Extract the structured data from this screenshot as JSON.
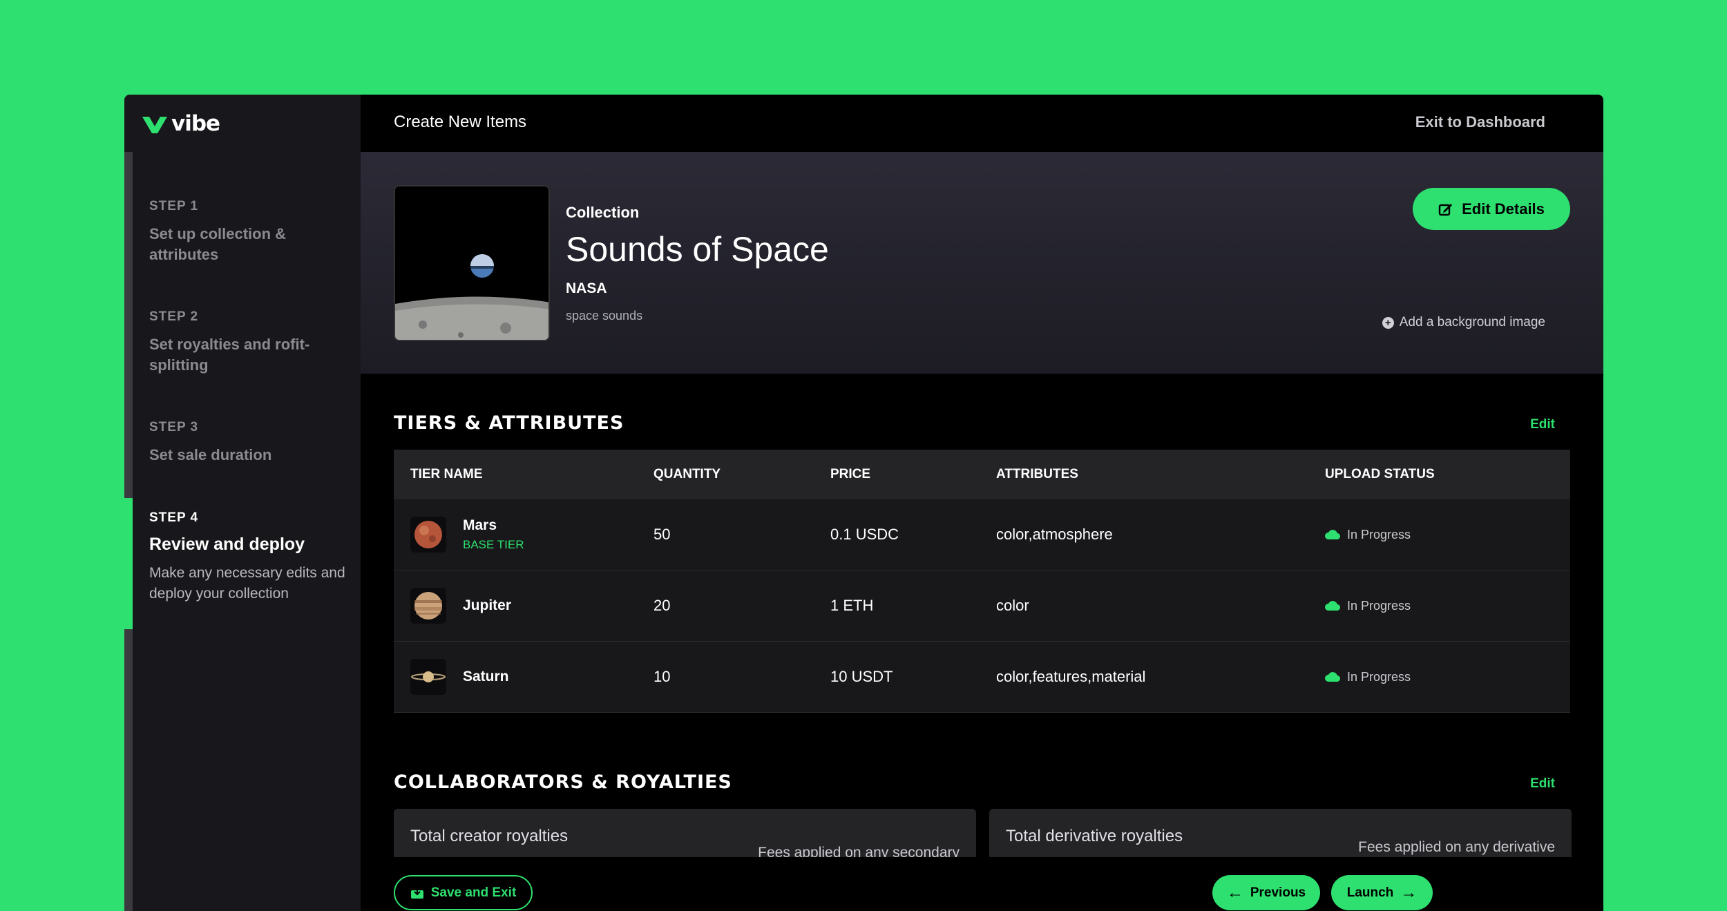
{
  "brand": {
    "name": "vibe",
    "logo_icon": "vibe-logo-icon",
    "accent": "#2ee06f"
  },
  "topbar": {
    "title": "Create New Items",
    "exit_label": "Exit to Dashboard"
  },
  "steps": [
    {
      "num": "STEP 1",
      "title": "Set up collection & attributes"
    },
    {
      "num": "STEP 2",
      "title": "Set royalties and rofit-splitting"
    },
    {
      "num": "STEP 3",
      "title": "Set sale duration"
    },
    {
      "num": "STEP 4",
      "title": "Review and deploy",
      "desc": "Make any necessary edits and deploy your collection"
    }
  ],
  "collection": {
    "label": "Collection",
    "name": "Sounds of Space",
    "creator": "NASA",
    "description": "space sounds",
    "edit_label": "Edit Details",
    "add_bg_label": "Add a background image"
  },
  "tiers": {
    "title": "TIERS & ATTRIBUTES",
    "edit_label": "Edit",
    "headers": [
      "TIER NAME",
      "QUANTITY",
      "PRICE",
      "ATTRIBUTES",
      "UPLOAD STATUS"
    ],
    "rows": [
      {
        "name": "Mars",
        "sub": "BASE TIER",
        "quantity": "50",
        "price": "0.1 USDC",
        "attributes": "color,atmosphere",
        "status": "In Progress",
        "icon": "mars-icon"
      },
      {
        "name": "Jupiter",
        "sub": "",
        "quantity": "20",
        "price": "1 ETH",
        "attributes": "color",
        "status": "In Progress",
        "icon": "jupiter-icon"
      },
      {
        "name": "Saturn",
        "sub": "",
        "quantity": "10",
        "price": "10 USDT",
        "attributes": "color,features,material",
        "status": "In Progress",
        "icon": "saturn-icon"
      }
    ]
  },
  "collaborators": {
    "title": "COLLABORATORS & ROYALTIES",
    "edit_label": "Edit",
    "creator_title": "Total creator royalties",
    "creator_desc": "Fees applied on any secondary",
    "derivative_title": "Total derivative royalties",
    "derivative_desc": "Fees applied on any derivative"
  },
  "footer": {
    "save_label": "Save and Exit",
    "previous_label": "Previous",
    "launch_label": "Launch"
  }
}
